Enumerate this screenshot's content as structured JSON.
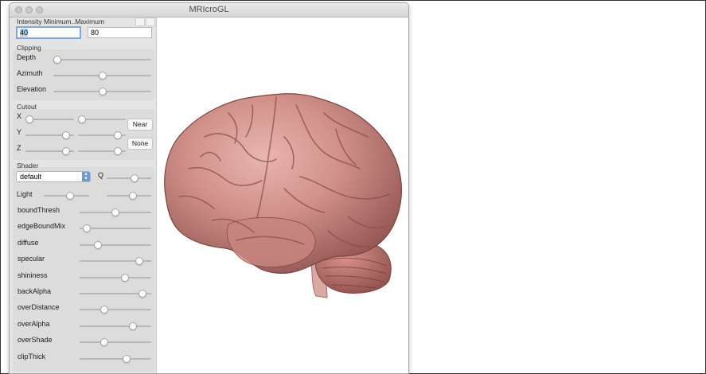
{
  "window": {
    "title": "MRIcroGL"
  },
  "intensity": {
    "label": "Intensity Minimum..Maximum",
    "min_value": "40",
    "max_value": "80"
  },
  "clipping": {
    "label": "Clipping",
    "sliders": [
      {
        "name": "Depth",
        "value": 0.0
      },
      {
        "name": "Azimuth",
        "value": 0.5
      },
      {
        "name": "Elevation",
        "value": 0.5
      }
    ]
  },
  "cutout": {
    "label": "Cutout",
    "axes": [
      "X",
      "Y",
      "Z"
    ],
    "lo_values": [
      0.0,
      0.9,
      0.9
    ],
    "hi_values": [
      0.0,
      0.9,
      0.9
    ],
    "near_label": "Near",
    "none_label": "None"
  },
  "shader": {
    "label": "Shader",
    "selected": "default",
    "q_label": "Q",
    "q_value": 0.65,
    "light_label": "Light",
    "light_values": [
      0.6,
      0.6
    ],
    "params": [
      {
        "name": "boundThresh",
        "value": 0.5
      },
      {
        "name": "edgeBoundMix",
        "value": 0.05
      },
      {
        "name": "diffuse",
        "value": 0.22
      },
      {
        "name": "specular",
        "value": 0.88
      },
      {
        "name": "shininess",
        "value": 0.65
      },
      {
        "name": "backAlpha",
        "value": 0.93
      },
      {
        "name": "overDistance",
        "value": 0.32
      },
      {
        "name": "overAlpha",
        "value": 0.78
      },
      {
        "name": "overShade",
        "value": 0.32
      },
      {
        "name": "clipThick",
        "value": 0.68
      }
    ]
  },
  "render": {
    "subject": "brain-render",
    "color": "#c98a84"
  }
}
